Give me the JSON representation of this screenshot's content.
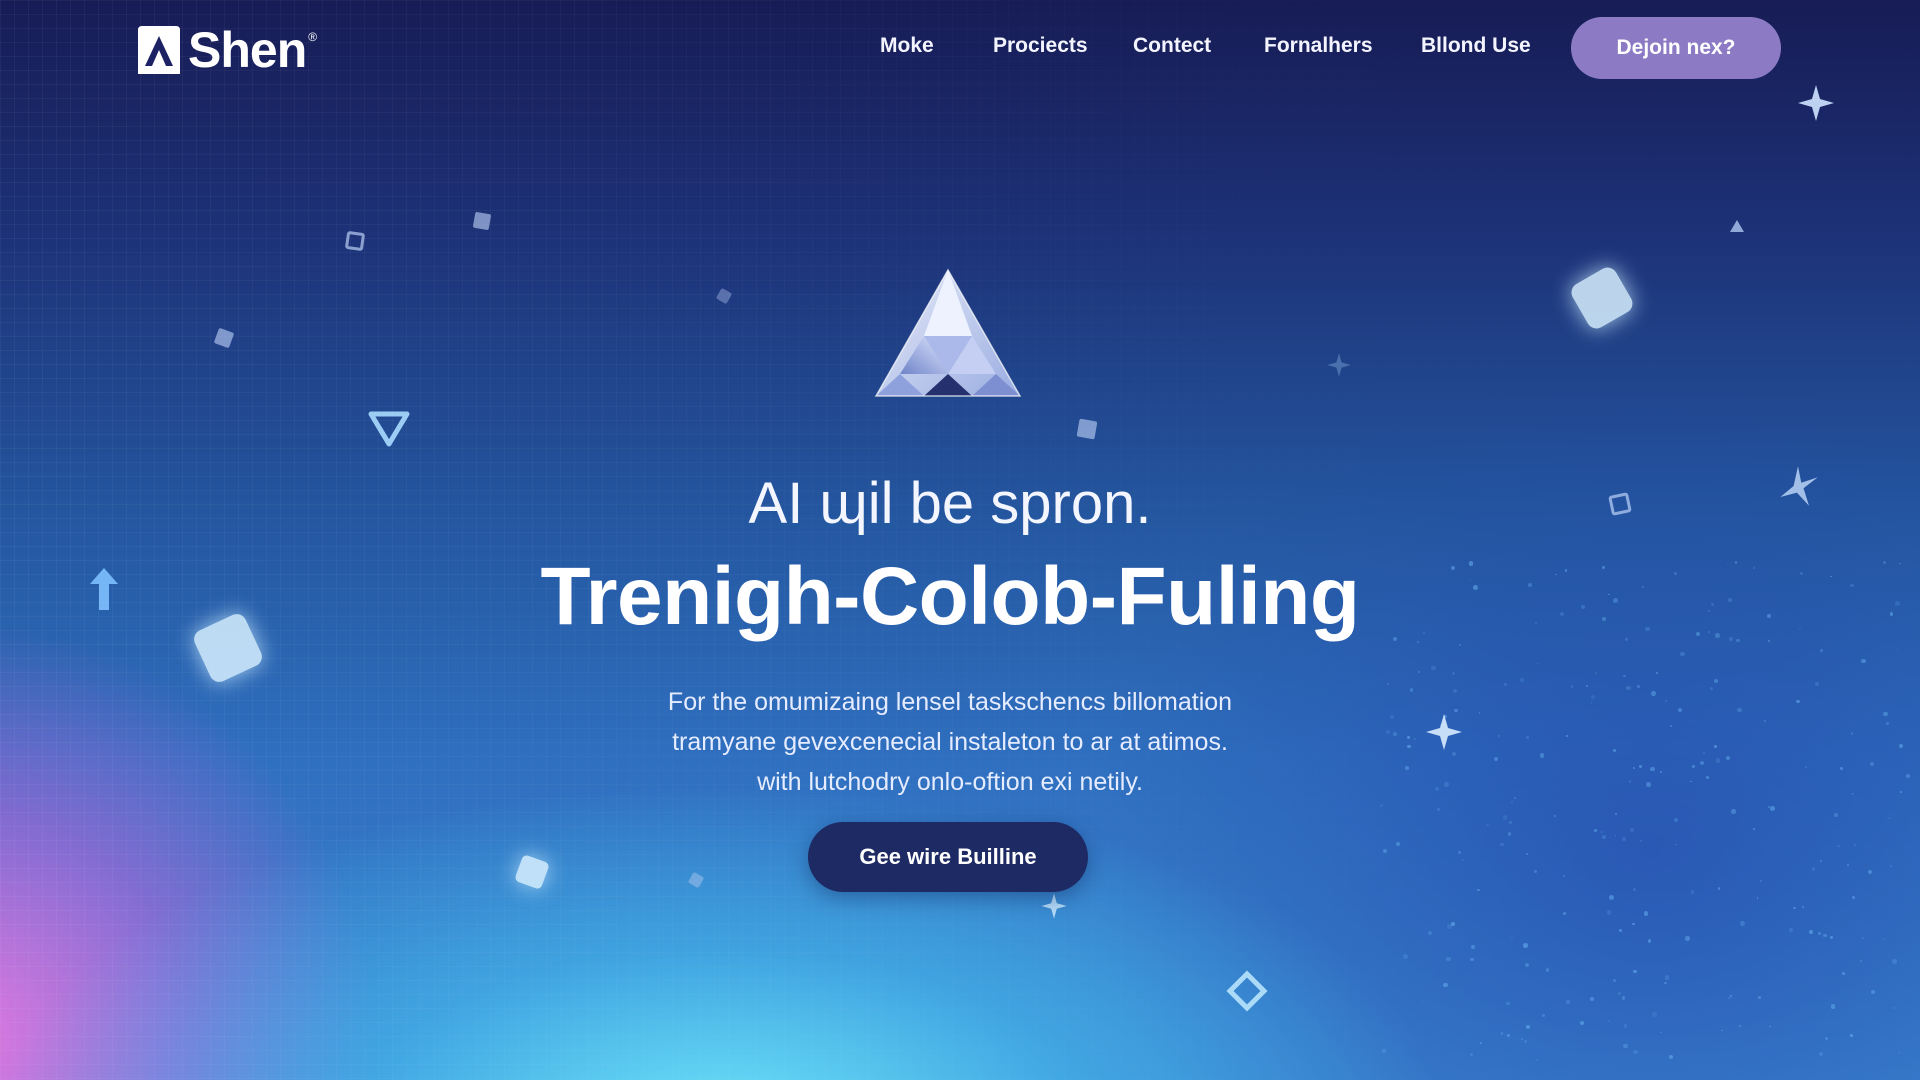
{
  "brand": {
    "name": "Shen",
    "registered_mark": "®"
  },
  "nav": {
    "links": [
      "Moke",
      "Prociects",
      "Contect",
      "Fornalhers",
      "Bllond Use"
    ],
    "cta_label": "Dejoin nex?"
  },
  "hero": {
    "subtitle": "AI ɰil be spron.",
    "title": "Trenigh-Colob-Fuling",
    "description_lines": [
      "For the omumizaing lensel taskschencs billomation",
      "tramyane gevexcenecial instaleton to ar at atimos.",
      "with lutchodry onlo-oftion exi netily."
    ],
    "cta_label": "Gee wire Builline"
  },
  "colors": {
    "nav_cta_bg": "#8c7ac4",
    "hero_cta_bg": "#1e2a63",
    "bg_top": "#171c55",
    "bg_glow_cyan": "#6ee6fa",
    "bg_glow_pink": "#eb78e1"
  },
  "icons": {
    "logo": "triangle-logo-icon",
    "emblem": "crystal-pyramid-icon",
    "decorations": [
      "sparkle-icon",
      "cube-icon",
      "triangle-outline-icon",
      "arrow-up-icon"
    ]
  }
}
